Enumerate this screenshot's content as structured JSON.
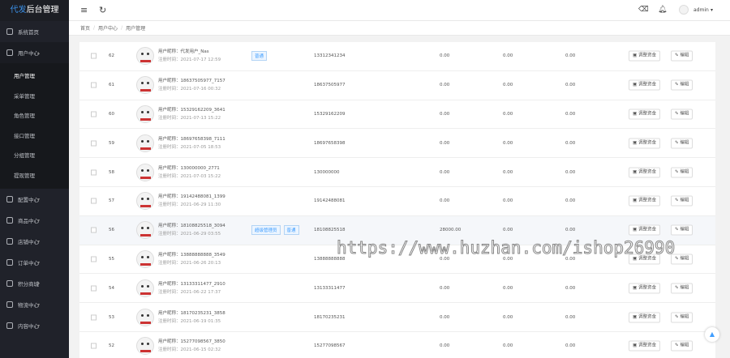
{
  "app": {
    "title_a": "代发",
    "title_b": "后台管理",
    "user": "admin"
  },
  "sidebar": {
    "home": "系统首页",
    "user_center": "用户中心",
    "user_sub": [
      "用户管理",
      "采单管理",
      "角色管理",
      "接口管理",
      "分组管理",
      "提现管理"
    ],
    "groups": [
      "配置中心",
      "商品中心",
      "店铺中心",
      "订单中心",
      "积分商城",
      "物流中心",
      "内容中心"
    ]
  },
  "breadcrumb": [
    "首页",
    "用户中心",
    "用户管理"
  ],
  "labels": {
    "nick": "用户昵称：",
    "reg": "注册时间：",
    "adjust": "调整资金",
    "edit": "编辑"
  },
  "rows": [
    {
      "id": "62",
      "nick": "代发用户_Nas",
      "reg": "2021-07-17 12:59",
      "tags": [
        "普通"
      ],
      "phone": "13312341234",
      "a": "0.00",
      "b": "0.00",
      "c": "0.00"
    },
    {
      "id": "61",
      "nick": "18637505977_7157",
      "reg": "2021-07-16 00:32",
      "tags": [],
      "phone": "18637505977",
      "a": "0.00",
      "b": "0.00",
      "c": "0.00"
    },
    {
      "id": "60",
      "nick": "15329162209_3641",
      "reg": "2021-07-13 15:22",
      "tags": [],
      "phone": "15329162209",
      "a": "0.00",
      "b": "0.00",
      "c": "0.00"
    },
    {
      "id": "59",
      "nick": "18697658398_7111",
      "reg": "2021-07-05 18:53",
      "tags": [],
      "phone": "18697658398",
      "a": "0.00",
      "b": "0.00",
      "c": "0.00"
    },
    {
      "id": "58",
      "nick": "130000000_2771",
      "reg": "2021-07-03 15:22",
      "tags": [],
      "phone": "130000000",
      "a": "0.00",
      "b": "0.00",
      "c": "0.00"
    },
    {
      "id": "57",
      "nick": "19142488081_1399",
      "reg": "2021-06-29 11:30",
      "tags": [],
      "phone": "19142488081",
      "a": "0.00",
      "b": "0.00",
      "c": "0.00"
    },
    {
      "id": "56",
      "nick": "18108825518_3094",
      "reg": "2021-06-29 03:55",
      "tags": [
        "超级管理员",
        "普通"
      ],
      "phone": "18108825518",
      "a": "28000.00",
      "b": "0.00",
      "c": "0.00"
    },
    {
      "id": "55",
      "nick": "13888888888_3549",
      "reg": "2021-06-26 20:13",
      "tags": [],
      "phone": "13888888888",
      "a": "0.00",
      "b": "0.00",
      "c": "0.00"
    },
    {
      "id": "54",
      "nick": "13133311477_2910",
      "reg": "2021-06-22 17:37",
      "tags": [],
      "phone": "13133311477",
      "a": "0.00",
      "b": "0.00",
      "c": "0.00"
    },
    {
      "id": "53",
      "nick": "18170235231_3858",
      "reg": "2021-06-19 01:35",
      "tags": [],
      "phone": "18170235231",
      "a": "0.00",
      "b": "0.00",
      "c": "0.00"
    },
    {
      "id": "52",
      "nick": "15277098567_3850",
      "reg": "2021-06-15 02:32",
      "tags": [],
      "phone": "15277098567",
      "a": "0.00",
      "b": "0.00",
      "c": "0.00"
    }
  ],
  "watermark": "https://www.huzhan.com/ishop26990"
}
